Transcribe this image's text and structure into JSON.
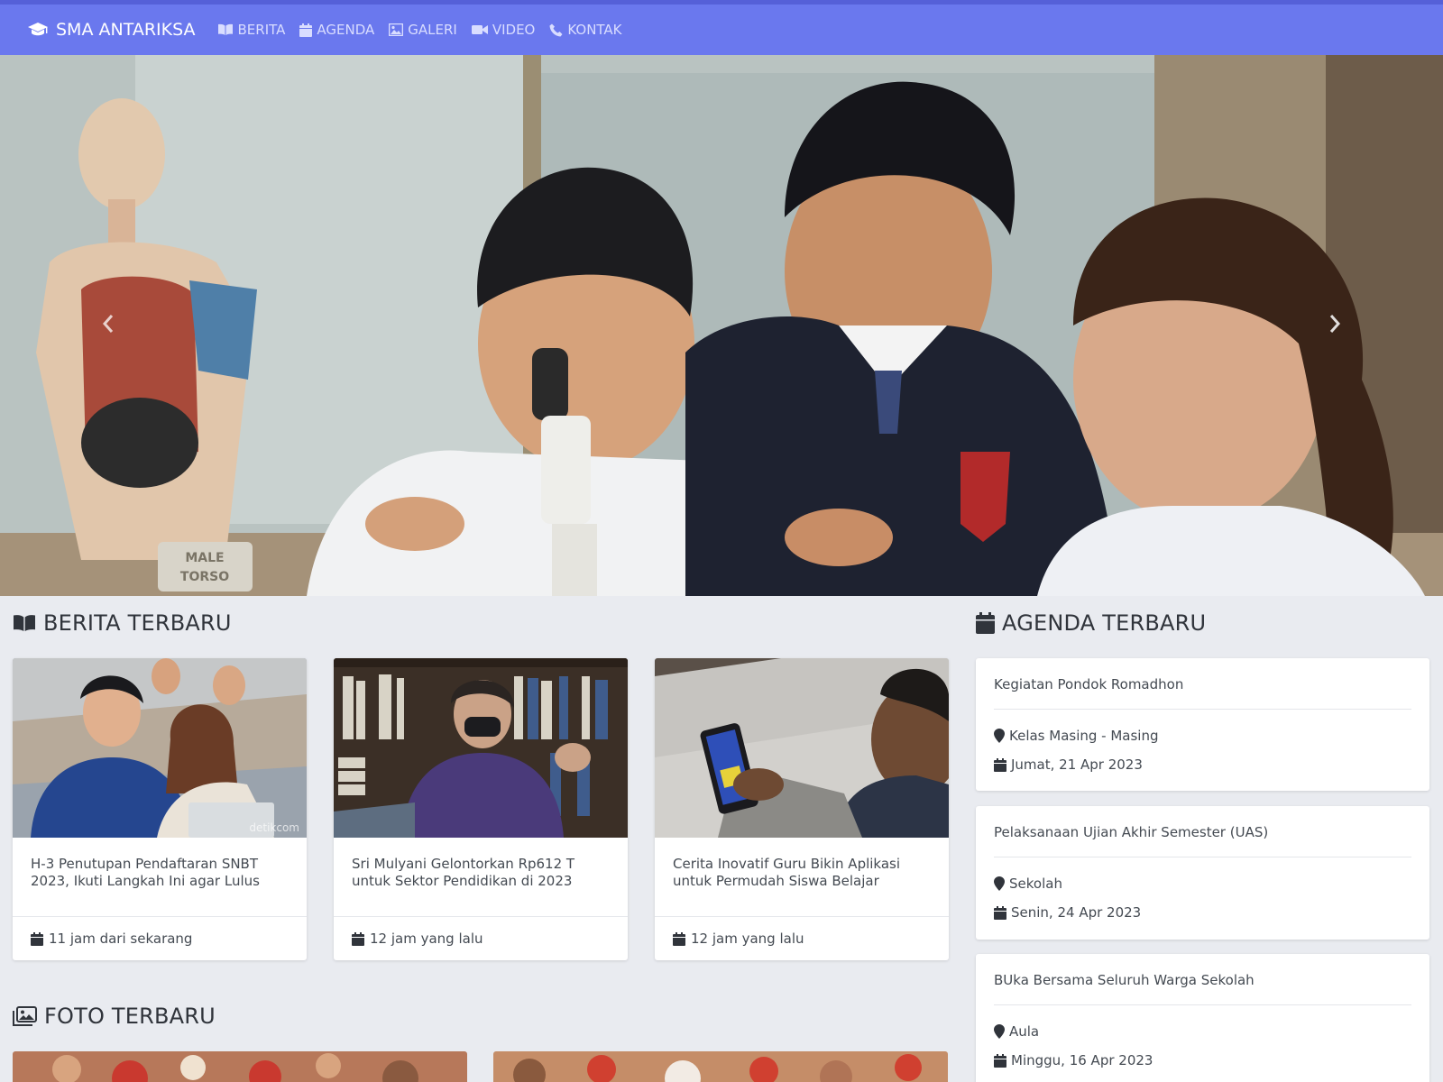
{
  "navbar": {
    "brand": "SMA ANTARIKSA",
    "items": [
      {
        "label": "BERITA",
        "icon": "book-open-icon"
      },
      {
        "label": "AGENDA",
        "icon": "calendar-icon"
      },
      {
        "label": "GALERI",
        "icon": "image-icon"
      },
      {
        "label": "VIDEO",
        "icon": "video-icon"
      },
      {
        "label": "KONTAK",
        "icon": "phone-icon"
      }
    ]
  },
  "hero": {
    "caption_sign": "MALE TORSO"
  },
  "berita": {
    "title": "BERITA TERBARU",
    "cards": [
      {
        "title": "H-3 Penutupan Pendaftaran SNBT 2023, Ikuti Langkah Ini agar Lulus",
        "time": "11 jam dari sekarang",
        "watermark": "detikcom"
      },
      {
        "title": "Sri Mulyani Gelontorkan Rp612 T untuk Sektor Pendidikan di 2023",
        "time": "12 jam yang lalu"
      },
      {
        "title": "Cerita Inovatif Guru Bikin Aplikasi untuk Permudah Siswa Belajar",
        "time": "12 jam yang lalu"
      }
    ]
  },
  "agenda": {
    "title": "AGENDA TERBARU",
    "items": [
      {
        "title": "Kegiatan Pondok Romadhon",
        "location": "Kelas Masing - Masing",
        "date": "Jumat, 21 Apr 2023"
      },
      {
        "title": "Pelaksanaan Ujian Akhir Semester (UAS)",
        "location": "Sekolah",
        "date": "Senin, 24 Apr 2023"
      },
      {
        "title": "BUka Bersama Seluruh Warga Sekolah",
        "location": "Aula",
        "date": "Minggu, 16 Apr 2023"
      }
    ]
  },
  "foto": {
    "title": "FOTO TERBARU"
  },
  "colors": {
    "navbar": "#6a78ee",
    "topline": "#5560d8",
    "background": "#e9ebf0"
  }
}
